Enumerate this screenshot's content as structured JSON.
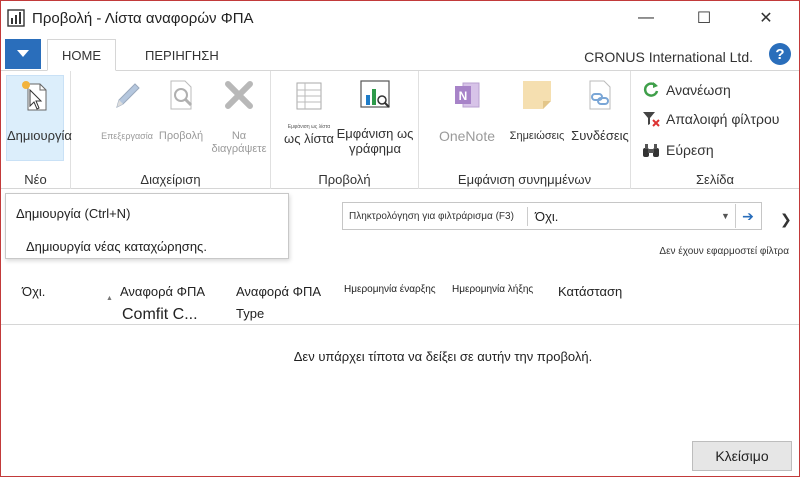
{
  "window": {
    "title": "Προβολή - Λίστα αναφορών ΦΠΑ",
    "minimize": "—",
    "maximize": "☐",
    "close": "✕"
  },
  "tabs": {
    "home": "HOME",
    "navigate": "ΠΕΡΙΗΓΗΣΗ"
  },
  "company": "CRONUS International Ltd.",
  "help": "?",
  "ribbon": {
    "new_group": {
      "label": "Νέο",
      "new": "Δημιουργία"
    },
    "manage_group": {
      "label": "Διαχείριση",
      "edit": "Επεξεργασία",
      "view": "Προβολή",
      "delete": "Να διαγράψετε"
    },
    "view_group": {
      "label": "Προβολή",
      "show_as_list_small": "Εμφάνιση ως λίστα",
      "show_as_list": "ως λίστα",
      "show_as_chart": "Εμφάνιση ως γράφημα"
    },
    "attachments_group": {
      "label": "Εμφάνιση συνημμένων",
      "onenote": "OneNote",
      "notes": "Σημειώσεις",
      "links": "Συνδέσεις"
    },
    "page_group": {
      "label": "Σελίδα",
      "refresh": "Ανανέωση",
      "clear_filter": "Απαλοιφή φίλτρου",
      "find": "Εύρεση"
    }
  },
  "tooltip": {
    "title": "Δημιουργία (Ctrl+N)",
    "description": "Δημιουργία νέας καταχώρησης."
  },
  "filter": {
    "label": "Πληκτρολόγηση για φιλτράρισμα (F3)",
    "value": "Όχι.",
    "status": "Δεν έχουν εφαρμοστεί φίλτρα"
  },
  "columns": {
    "no": "Όχι.",
    "vat_report_config": "Αναφορά ΦΠΑ",
    "vat_report_config_value": "Comfit C...",
    "vat_report_type": "Αναφορά ΦΠΑ",
    "vat_report_type_2": "Type",
    "start_date": "Ημερομηνία έναρξης",
    "end_date": "Ημερομηνία λήξης",
    "status": "Κατάσταση"
  },
  "empty_message": "Δεν υπάρχει τίποτα να δείξει σε αυτήν την προβολή.",
  "close_button": "Κλείσιμο",
  "colors": {
    "accent": "#2a6ebb",
    "selected": "#dceefb",
    "border": "#c23a3a"
  }
}
